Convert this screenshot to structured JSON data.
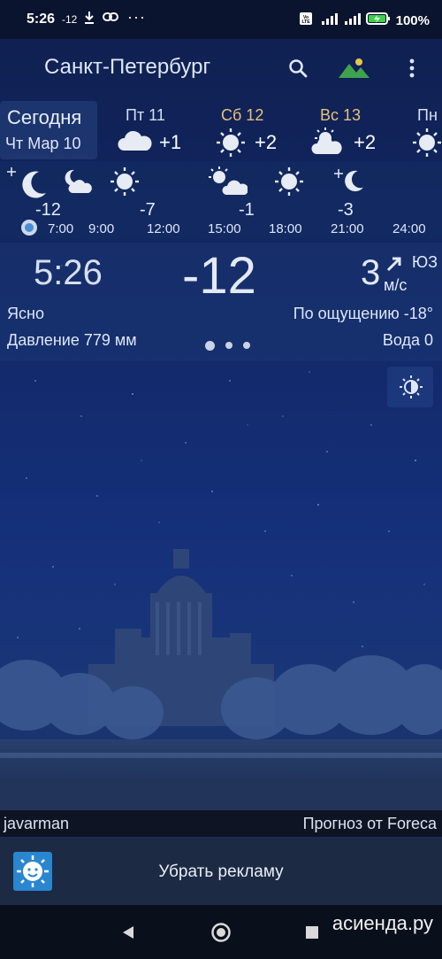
{
  "status_bar": {
    "time": "5:26",
    "temp": "-12",
    "more": "···",
    "battery": "100%"
  },
  "app_bar": {
    "city": "Санкт-Петербург",
    "search_icon": "search-icon",
    "landscape_icon": "landscape-icon",
    "menu_icon": "more-vert-icon"
  },
  "tabs": {
    "today_label": "Сегодня",
    "today_date": "Чт Мар 10",
    "days": [
      {
        "label": "Пт 11",
        "temp": "+1",
        "icon": "partly-cloudy-icon",
        "color": "#d8dff0"
      },
      {
        "label": "Сб 12",
        "temp": "+2",
        "icon": "sun-icon",
        "color": "#e7c27a"
      },
      {
        "label": "Вс 13",
        "temp": "+2",
        "icon": "partly-sunny-icon",
        "color": "#e7c27a"
      },
      {
        "label": "Пн",
        "temp": "",
        "icon": "sun-icon",
        "color": "#d8dff0"
      }
    ]
  },
  "hourly": {
    "temps": [
      "-12",
      "-7",
      "-1",
      "-3"
    ],
    "times": [
      "7:00",
      "9:00",
      "12:00",
      "15:00",
      "18:00",
      "21:00",
      "24:00"
    ]
  },
  "current": {
    "time": "5:26",
    "temp": "-12",
    "wind_speed": "3",
    "wind_dir": "ЮЗ",
    "wind_unit": "м/с",
    "condition": "Ясно",
    "feels_like": "По ощущению -18°",
    "pressure": "Давление 779 мм",
    "precip": "Вода 0"
  },
  "footer": {
    "author": "javarman",
    "provider": "Прогноз от Foreca"
  },
  "ad": {
    "label": "Убрать рекламу"
  },
  "watermark": "асиенда.ру"
}
